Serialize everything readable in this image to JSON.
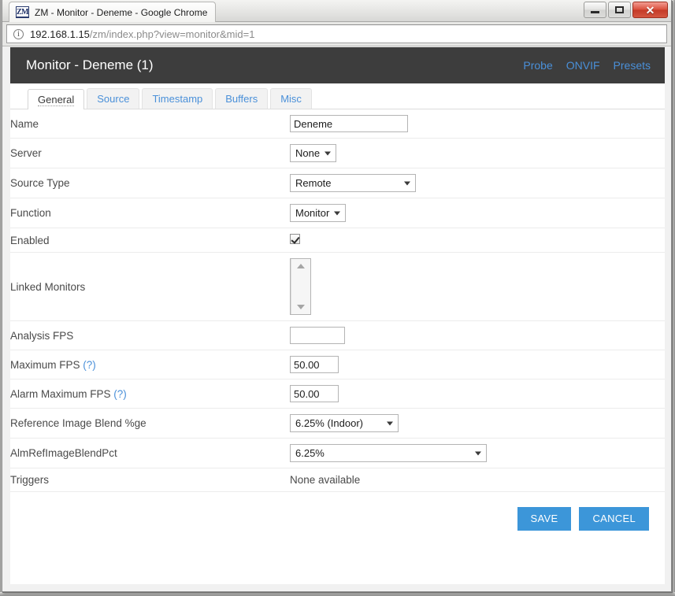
{
  "window": {
    "tab_title": "ZM - Monitor - Deneme - Google Chrome",
    "favicon_text": "ZM",
    "minimize_label": "",
    "maximize_label": "",
    "close_label": "✕"
  },
  "omnibox": {
    "info_icon_glyph": "i",
    "url_host": "192.168.1.15",
    "url_path": "/zm/index.php?view=monitor&mid=1"
  },
  "page": {
    "title": "Monitor - Deneme (1)",
    "header_links": [
      {
        "label": "Probe"
      },
      {
        "label": "ONVIF"
      },
      {
        "label": "Presets"
      }
    ],
    "tabs": [
      {
        "label": "General",
        "active": true
      },
      {
        "label": "Source",
        "active": false
      },
      {
        "label": "Timestamp",
        "active": false
      },
      {
        "label": "Buffers",
        "active": false
      },
      {
        "label": "Misc",
        "active": false
      }
    ],
    "fields": {
      "name": {
        "label": "Name",
        "value": "Deneme"
      },
      "server": {
        "label": "Server",
        "value": "None"
      },
      "source_type": {
        "label": "Source Type",
        "value": "Remote"
      },
      "function": {
        "label": "Function",
        "value": "Monitor"
      },
      "enabled": {
        "label": "Enabled",
        "checked": true
      },
      "linked_monitors": {
        "label": "Linked Monitors",
        "value": ""
      },
      "analysis_fps": {
        "label": "Analysis FPS",
        "value": ""
      },
      "maximum_fps": {
        "label": "Maximum FPS",
        "help": "(?)",
        "value": "50.00"
      },
      "alarm_maximum_fps": {
        "label": "Alarm Maximum FPS",
        "help": "(?)",
        "value": "50.00"
      },
      "ref_image_blend": {
        "label": "Reference Image Blend %ge",
        "value": "6.25% (Indoor)"
      },
      "alm_ref_image_blend": {
        "label": "AlmRefImageBlendPct",
        "value": "6.25%"
      },
      "triggers": {
        "label": "Triggers",
        "value": "None available"
      }
    },
    "buttons": {
      "save": "SAVE",
      "cancel": "CANCEL"
    }
  },
  "colors": {
    "header_bg": "#3d3d3d",
    "link_blue": "#4a90d9",
    "button_blue": "#3c96d9",
    "close_red": "#c43a27"
  }
}
